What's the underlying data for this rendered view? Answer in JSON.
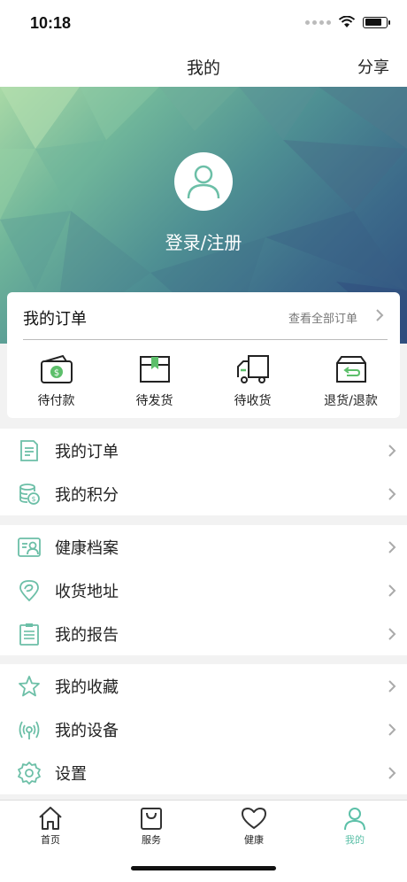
{
  "status_bar": {
    "time": "10:18"
  },
  "nav": {
    "title": "我的",
    "share_label": "分享"
  },
  "hero": {
    "login_label": "登录/注册"
  },
  "order_card": {
    "title": "我的订单",
    "view_all_label": "查看全部订单",
    "statuses": [
      {
        "label": "待付款",
        "icon": "wallet-icon"
      },
      {
        "label": "待发货",
        "icon": "package-icon"
      },
      {
        "label": "待收货",
        "icon": "truck-icon"
      },
      {
        "label": "退货/退款",
        "icon": "return-box-icon"
      }
    ]
  },
  "menu": {
    "group1": [
      {
        "label": "我的订单",
        "icon": "order-list-icon"
      },
      {
        "label": "我的积分",
        "icon": "coins-icon"
      }
    ],
    "group2": [
      {
        "label": "健康档案",
        "icon": "health-record-icon"
      },
      {
        "label": "收货地址",
        "icon": "location-pin-icon"
      },
      {
        "label": "我的报告",
        "icon": "report-icon"
      }
    ],
    "group3": [
      {
        "label": "我的收藏",
        "icon": "star-icon"
      },
      {
        "label": "我的设备",
        "icon": "device-signal-icon"
      },
      {
        "label": "设置",
        "icon": "gear-icon"
      }
    ]
  },
  "tabs": [
    {
      "label": "首页",
      "icon": "home-icon",
      "active": false
    },
    {
      "label": "服务",
      "icon": "bag-icon",
      "active": false
    },
    {
      "label": "健康",
      "icon": "heart-icon",
      "active": false
    },
    {
      "label": "我的",
      "icon": "user-icon",
      "active": true
    }
  ],
  "colors": {
    "accent": "#5cc0a8",
    "icon_teal": "#6cbfa7"
  }
}
